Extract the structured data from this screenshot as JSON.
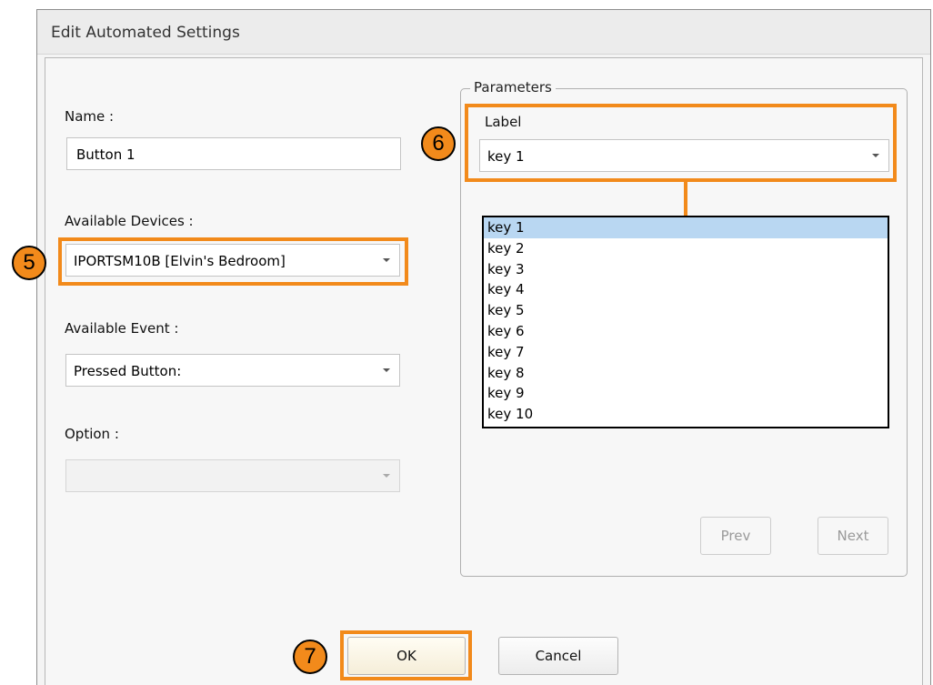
{
  "dialog": {
    "title": "Edit Automated Settings"
  },
  "form": {
    "name_label": "Name :",
    "name_value": "Button 1",
    "devices_label": "Available Devices :",
    "devices_value": "IPORTSM10B [Elvin's Bedroom]",
    "event_label": "Available Event :",
    "event_value": "Pressed Button:",
    "option_label": "Option :",
    "option_value": ""
  },
  "parameters": {
    "group_title": "Parameters",
    "label_caption": "Label",
    "label_value": "key 1",
    "options": [
      "key 1",
      "key 2",
      "key 3",
      "key 4",
      "key 5",
      "key 6",
      "key 7",
      "key 8",
      "key 9",
      "key 10"
    ],
    "selected_option": "key 1",
    "prev_label": "Prev",
    "next_label": "Next"
  },
  "footer": {
    "ok_label": "OK",
    "cancel_label": "Cancel"
  },
  "callouts": {
    "devices_step": "5",
    "label_step": "6",
    "ok_step": "7"
  },
  "colors": {
    "highlight": "#f28a1b",
    "selection": "#b9d7f2"
  }
}
